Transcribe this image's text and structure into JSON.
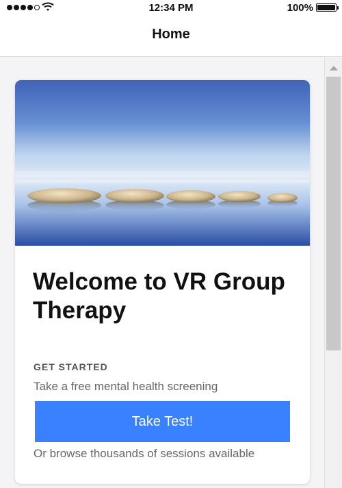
{
  "status_bar": {
    "time": "12:34 PM",
    "battery": "100%",
    "signal_bars_filled": 4,
    "signal_bars_total": 5,
    "battery_level": 1.0,
    "icons": [
      "signal-icon",
      "wifi-icon",
      "battery-icon"
    ]
  },
  "nav": {
    "title": "Home"
  },
  "card": {
    "image_icon": "zen-stones-water-photo",
    "title": "Welcome to VR Group Therapy",
    "overline": "GET STARTED",
    "subtitle": "Take a free mental health screening",
    "cta_label": "Take Test!",
    "footnote": "Or browse thousands of sessions available"
  },
  "colors": {
    "accent": "#3a81ff",
    "background": "#f4f4f6",
    "card": "#ffffff",
    "title_text": "#111111",
    "secondary_text": "#666666"
  }
}
